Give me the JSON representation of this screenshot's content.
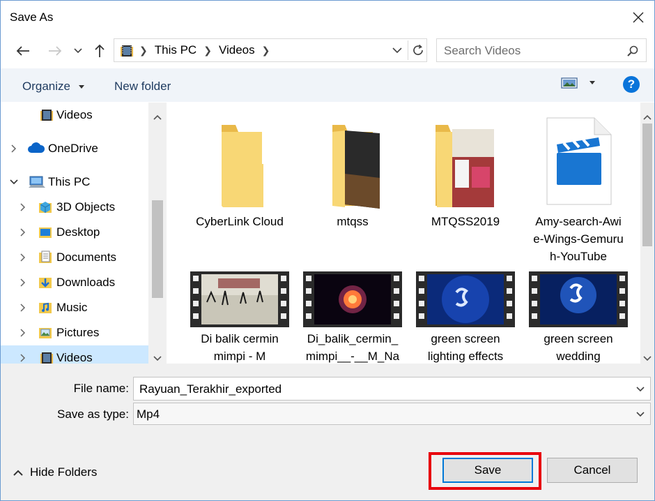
{
  "window": {
    "title": "Save As",
    "close_icon": "close-icon"
  },
  "nav": {
    "back_icon": "arrow-left-icon",
    "forward_icon": "arrow-right-icon",
    "recent_icon": "chevron-down-icon",
    "up_icon": "arrow-up-icon",
    "address": [
      "This PC",
      "Videos"
    ],
    "refresh_icon": "refresh-icon",
    "search_placeholder": "Search Videos",
    "search_icon": "search-icon"
  },
  "toolbar": {
    "organize": "Organize",
    "new_folder": "New folder",
    "view_icon": "view-icon",
    "help_icon": "help-icon"
  },
  "tree": [
    {
      "label": "Videos",
      "icon": "videos-folder-icon",
      "level": "top"
    },
    {
      "label": "OneDrive",
      "icon": "cloud-icon",
      "level": "root"
    },
    {
      "label": "This PC",
      "icon": "computer-icon",
      "level": "root",
      "expanded": true
    },
    {
      "label": "3D Objects",
      "icon": "3d-objects-icon",
      "level": "child"
    },
    {
      "label": "Desktop",
      "icon": "desktop-folder-icon",
      "level": "child"
    },
    {
      "label": "Documents",
      "icon": "documents-folder-icon",
      "level": "child"
    },
    {
      "label": "Downloads",
      "icon": "downloads-folder-icon",
      "level": "child"
    },
    {
      "label": "Music",
      "icon": "music-folder-icon",
      "level": "child"
    },
    {
      "label": "Pictures",
      "icon": "pictures-folder-icon",
      "level": "child"
    },
    {
      "label": "Videos",
      "icon": "videos-folder-icon",
      "level": "child",
      "selected": true
    }
  ],
  "files": [
    {
      "name_lines": [
        "CyberLink Cloud"
      ],
      "kind": "folder"
    },
    {
      "name_lines": [
        "mtqss"
      ],
      "kind": "folder-dark"
    },
    {
      "name_lines": [
        "MTQSS2019"
      ],
      "kind": "folder-photo"
    },
    {
      "name_lines": [
        "Amy-search-Awi",
        "e-Wings-Gemuru",
        "h-YouTube"
      ],
      "kind": "video-file"
    },
    {
      "name_lines": [
        "Di balik cermin",
        "mimpi  -  M"
      ],
      "kind": "video-thumb-lake"
    },
    {
      "name_lines": [
        "Di_balik_cermin_",
        "mimpi__-__M_Na"
      ],
      "kind": "video-thumb-glow"
    },
    {
      "name_lines": [
        "green screen",
        "lighting effects"
      ],
      "kind": "video-thumb-films"
    },
    {
      "name_lines": [
        "green screen",
        "wedding"
      ],
      "kind": "video-thumb-films2"
    }
  ],
  "form": {
    "file_name_label": "File name:",
    "file_name_value": "Rayuan_Terakhir_exported",
    "save_type_label": "Save as type:",
    "save_type_value": "Mp4"
  },
  "footer": {
    "hide_folders": "Hide Folders",
    "save": "Save",
    "cancel": "Cancel"
  },
  "colors": {
    "accent": "#0078d7",
    "highlight": "#e8000d",
    "folder": "#f8d775"
  }
}
